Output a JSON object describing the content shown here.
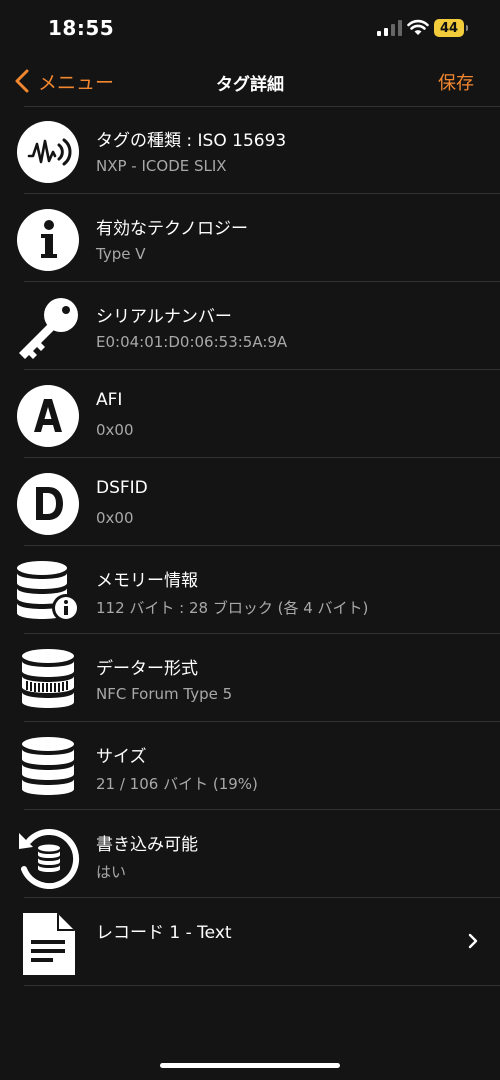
{
  "status_bar": {
    "time": "18:55",
    "battery": "44"
  },
  "nav": {
    "back_label": "メニュー",
    "title": "タグ詳細",
    "save_label": "保存"
  },
  "items": [
    {
      "icon": "nfc-tag-icon",
      "title": "タグの種類 : ISO 15693",
      "subtitle": "NXP - ICODE SLIX"
    },
    {
      "icon": "info-icon",
      "title": "有効なテクノロジー",
      "subtitle": "Type V"
    },
    {
      "icon": "key-icon",
      "title": "シリアルナンバー",
      "subtitle": "E0:04:01:D0:06:53:5A:9A"
    },
    {
      "icon": "letter-a-icon",
      "title": "AFI",
      "subtitle": "0x00"
    },
    {
      "icon": "letter-d-icon",
      "title": "DSFID",
      "subtitle": "0x00"
    },
    {
      "icon": "database-info-icon",
      "title": "メモリー情報",
      "subtitle": "112 バイト : 28 ブロック (各 4 バイト)"
    },
    {
      "icon": "database-format-icon",
      "title": "データー形式",
      "subtitle": "NFC Forum Type 5"
    },
    {
      "icon": "database-size-icon",
      "title": "サイズ",
      "subtitle": "21 / 106 バイト (19%)"
    },
    {
      "icon": "writable-icon",
      "title": "書き込み可能",
      "subtitle": "はい"
    },
    {
      "icon": "document-icon",
      "title": "レコード 1 - Text",
      "subtitle": ""
    }
  ],
  "colors": {
    "accent": "#f2872f",
    "background": "#141414",
    "separator": "#333333",
    "secondary_text": "#a8a8a8"
  }
}
